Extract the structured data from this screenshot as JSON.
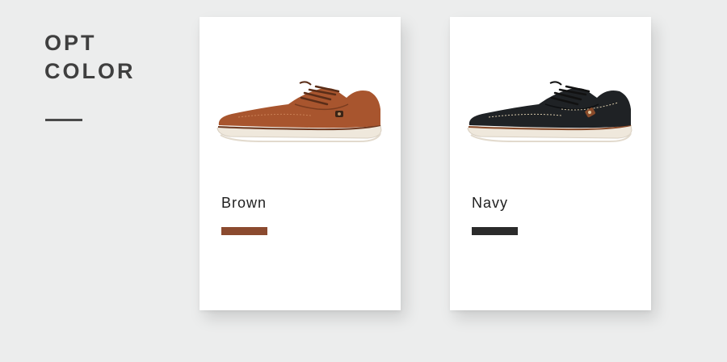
{
  "header": {
    "title_line1": "OPT",
    "title_line2": "COLOR"
  },
  "options": [
    {
      "label": "Brown",
      "swatch_color": "#8b4a2f",
      "upper_color": "#a8552e",
      "image": "brown-shoe-icon"
    },
    {
      "label": "Navy",
      "swatch_color": "#2b2b2b",
      "upper_color": "#1f2225",
      "image": "navy-shoe-icon"
    }
  ]
}
